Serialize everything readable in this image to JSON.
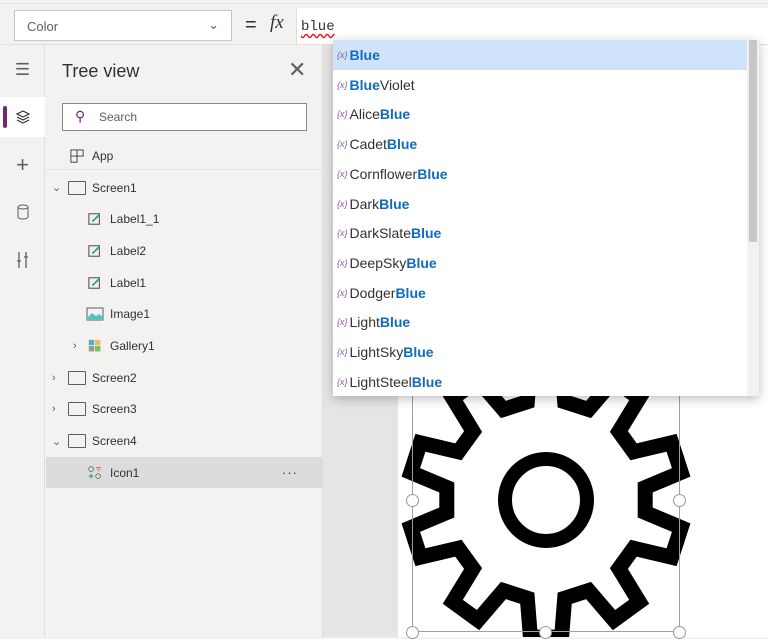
{
  "formula_bar": {
    "property": "Color",
    "equals": "=",
    "fx": "fx",
    "formula": "blue"
  },
  "rail": {
    "icons": [
      "hamburger-icon",
      "layers-icon",
      "add-icon",
      "database-icon",
      "tools-icon"
    ]
  },
  "tree": {
    "title": "Tree view",
    "search_placeholder": "Search",
    "nodes": [
      {
        "label": "App",
        "type": "app",
        "depth": 0,
        "expander": ""
      },
      {
        "label": "Screen1",
        "type": "screen",
        "depth": 0,
        "expander": "expanded"
      },
      {
        "label": "Label1_1",
        "type": "label",
        "depth": 1,
        "expander": ""
      },
      {
        "label": "Label2",
        "type": "label",
        "depth": 1,
        "expander": ""
      },
      {
        "label": "Label1",
        "type": "label",
        "depth": 1,
        "expander": ""
      },
      {
        "label": "Image1",
        "type": "image",
        "depth": 1,
        "expander": ""
      },
      {
        "label": "Gallery1",
        "type": "gallery",
        "depth": 1,
        "expander": "collapsed"
      },
      {
        "label": "Screen2",
        "type": "screen",
        "depth": 0,
        "expander": "collapsed"
      },
      {
        "label": "Screen3",
        "type": "screen",
        "depth": 0,
        "expander": "collapsed"
      },
      {
        "label": "Screen4",
        "type": "screen",
        "depth": 0,
        "expander": "expanded"
      },
      {
        "label": "Icon1",
        "type": "icon",
        "depth": 1,
        "expander": "",
        "selected": true,
        "more": "···"
      }
    ]
  },
  "autocomplete": {
    "var_icon": "{x}",
    "items": [
      {
        "pre": "",
        "match": "Blue",
        "post": ""
      },
      {
        "pre": "",
        "match": "Blue",
        "post": "Violet"
      },
      {
        "pre": "Alice",
        "match": "Blue",
        "post": ""
      },
      {
        "pre": "Cadet",
        "match": "Blue",
        "post": ""
      },
      {
        "pre": "Cornflower",
        "match": "Blue",
        "post": ""
      },
      {
        "pre": "Dark",
        "match": "Blue",
        "post": ""
      },
      {
        "pre": "DarkSlate",
        "match": "Blue",
        "post": ""
      },
      {
        "pre": "DeepSky",
        "match": "Blue",
        "post": ""
      },
      {
        "pre": "Dodger",
        "match": "Blue",
        "post": ""
      },
      {
        "pre": "Light",
        "match": "Blue",
        "post": ""
      },
      {
        "pre": "LightSky",
        "match": "Blue",
        "post": ""
      },
      {
        "pre": "LightSteel",
        "match": "Blue",
        "post": ""
      }
    ]
  },
  "colors": {
    "accent": "#742774",
    "match": "#0f6cbd",
    "highlight": "#cfe4fa"
  }
}
